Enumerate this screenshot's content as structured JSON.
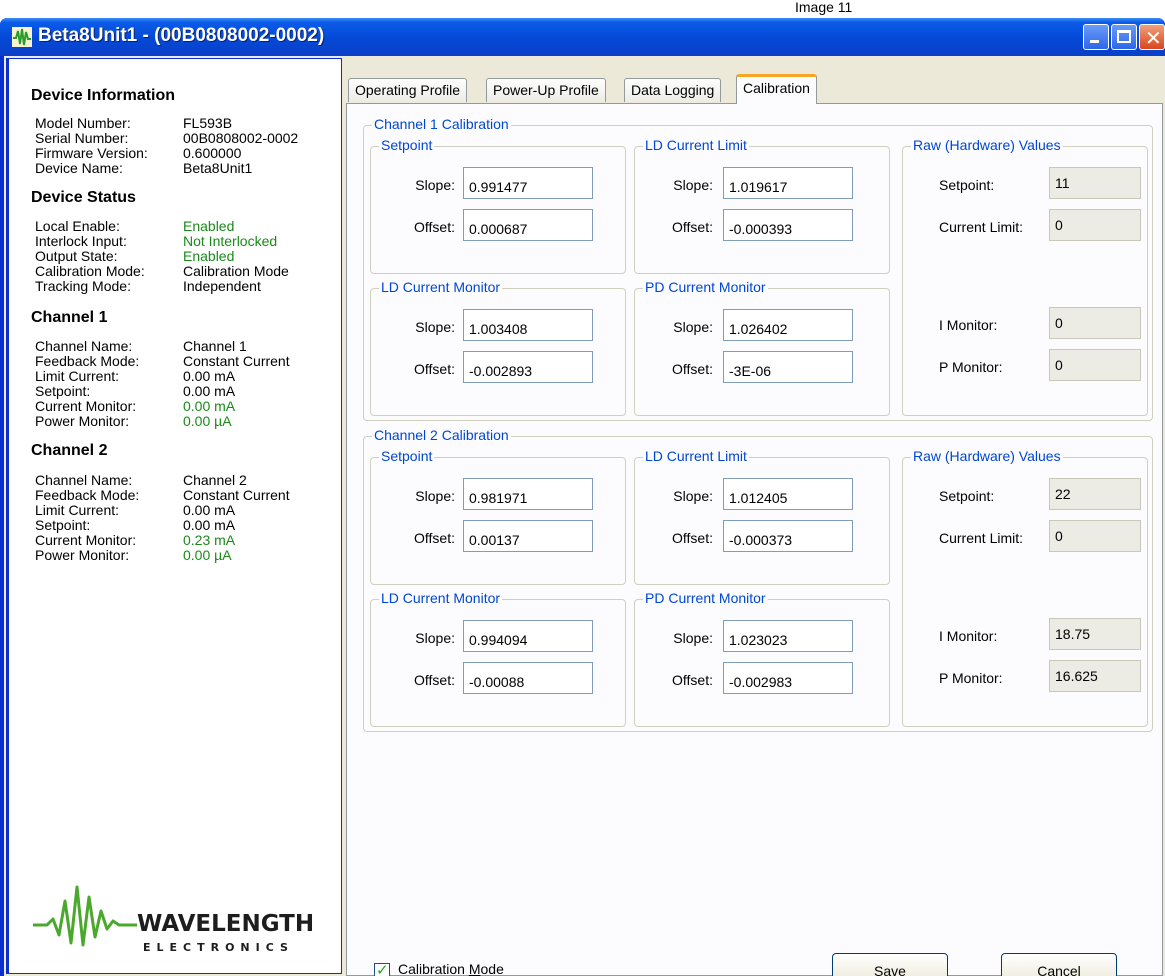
{
  "caption_strip": "Image 11",
  "window": {
    "title": "Beta8Unit1 - (00B0808002-0002)"
  },
  "info": {
    "device_information": {
      "title": "Device Information",
      "rows": [
        {
          "label": "Model Number:",
          "value": "FL593B"
        },
        {
          "label": "Serial Number:",
          "value": "00B0808002-0002"
        },
        {
          "label": "Firmware Version:",
          "value": "0.600000"
        },
        {
          "label": "Device Name:",
          "value": "Beta8Unit1"
        }
      ]
    },
    "device_status": {
      "title": "Device Status",
      "rows": [
        {
          "label": "Local Enable:",
          "value": "Enabled"
        },
        {
          "label": "Interlock Input:",
          "value": "Not Interlocked"
        },
        {
          "label": "Output State:",
          "value": "Enabled"
        },
        {
          "label": "Calibration Mode:",
          "value": "Calibration Mode"
        },
        {
          "label": "Tracking Mode:",
          "value": "Independent"
        }
      ]
    },
    "channel1": {
      "title": "Channel 1",
      "rows": [
        {
          "label": "Channel Name:",
          "value": "Channel 1"
        },
        {
          "label": "Feedback Mode:",
          "value": "Constant Current"
        },
        {
          "label": "Limit Current:",
          "value": "0.00 mA"
        },
        {
          "label": "Setpoint:",
          "value": "0.00 mA"
        },
        {
          "label": "Current Monitor:",
          "value": "0.00 mA"
        },
        {
          "label": "Power Monitor:",
          "value": "0.00 µA"
        }
      ]
    },
    "channel2": {
      "title": "Channel 2",
      "rows": [
        {
          "label": "Channel Name:",
          "value": "Channel 2"
        },
        {
          "label": "Feedback Mode:",
          "value": "Constant Current"
        },
        {
          "label": "Limit Current:",
          "value": "0.00 mA"
        },
        {
          "label": "Setpoint:",
          "value": "0.00 mA"
        },
        {
          "label": "Current Monitor:",
          "value": "0.23 mA"
        },
        {
          "label": "Power Monitor:",
          "value": "0.00 µA"
        }
      ]
    },
    "logo": {
      "word": "WAVELENGTH",
      "sub": "ELECTRONICS"
    }
  },
  "tabs": [
    "Operating Profile",
    "Power-Up Profile",
    "Data Logging",
    "Calibration"
  ],
  "labels": {
    "setpoint": "Setpoint",
    "ld_current_limit": "LD Current Limit",
    "ld_current_monitor": "LD Current Monitor",
    "pd_current_monitor": "PD Current Monitor",
    "raw_values": "Raw (Hardware) Values",
    "slope": "Slope:",
    "offset": "Offset:",
    "raw_setpoint": "Setpoint:",
    "raw_current_limit": "Current Limit:",
    "raw_i_monitor": "I Monitor:",
    "raw_p_monitor": "P Monitor:"
  },
  "ch1": {
    "title": "Channel 1 Calibration",
    "setpoint": {
      "slope": "0.991477",
      "offset": "0.000687"
    },
    "ld_current_limit": {
      "slope": "1.019617",
      "offset": "-0.000393"
    },
    "ld_current_monitor": {
      "slope": "1.003408",
      "offset": "-0.002893"
    },
    "pd_current_monitor": {
      "slope": "1.026402",
      "offset": "-3E-06"
    },
    "raw": {
      "setpoint": "11",
      "current_limit": "0",
      "i_monitor": "0",
      "p_monitor": "0"
    }
  },
  "ch2": {
    "title": "Channel 2 Calibration",
    "setpoint": {
      "slope": "0.981971",
      "offset": "0.00137"
    },
    "ld_current_limit": {
      "slope": "1.012405",
      "offset": "-0.000373"
    },
    "ld_current_monitor": {
      "slope": "0.994094",
      "offset": "-0.00088"
    },
    "pd_current_monitor": {
      "slope": "1.023023",
      "offset": "-0.002983"
    },
    "raw": {
      "setpoint": "22",
      "current_limit": "0",
      "i_monitor": "18.75",
      "p_monitor": "16.625"
    }
  },
  "footer": {
    "calibration_mode_checked": true,
    "calibration_mode_label_pre": "Calibration ",
    "calibration_mode_label_u": "M",
    "calibration_mode_label_post": "ode",
    "save_u": "S",
    "save_rest": "ave",
    "cancel_u": "C",
    "cancel_rest": "ancel"
  },
  "colors": {
    "accent_green": "#1a8a1a",
    "group_title_blue": "#0046d5",
    "titlebar_blue": "#0449d6"
  }
}
